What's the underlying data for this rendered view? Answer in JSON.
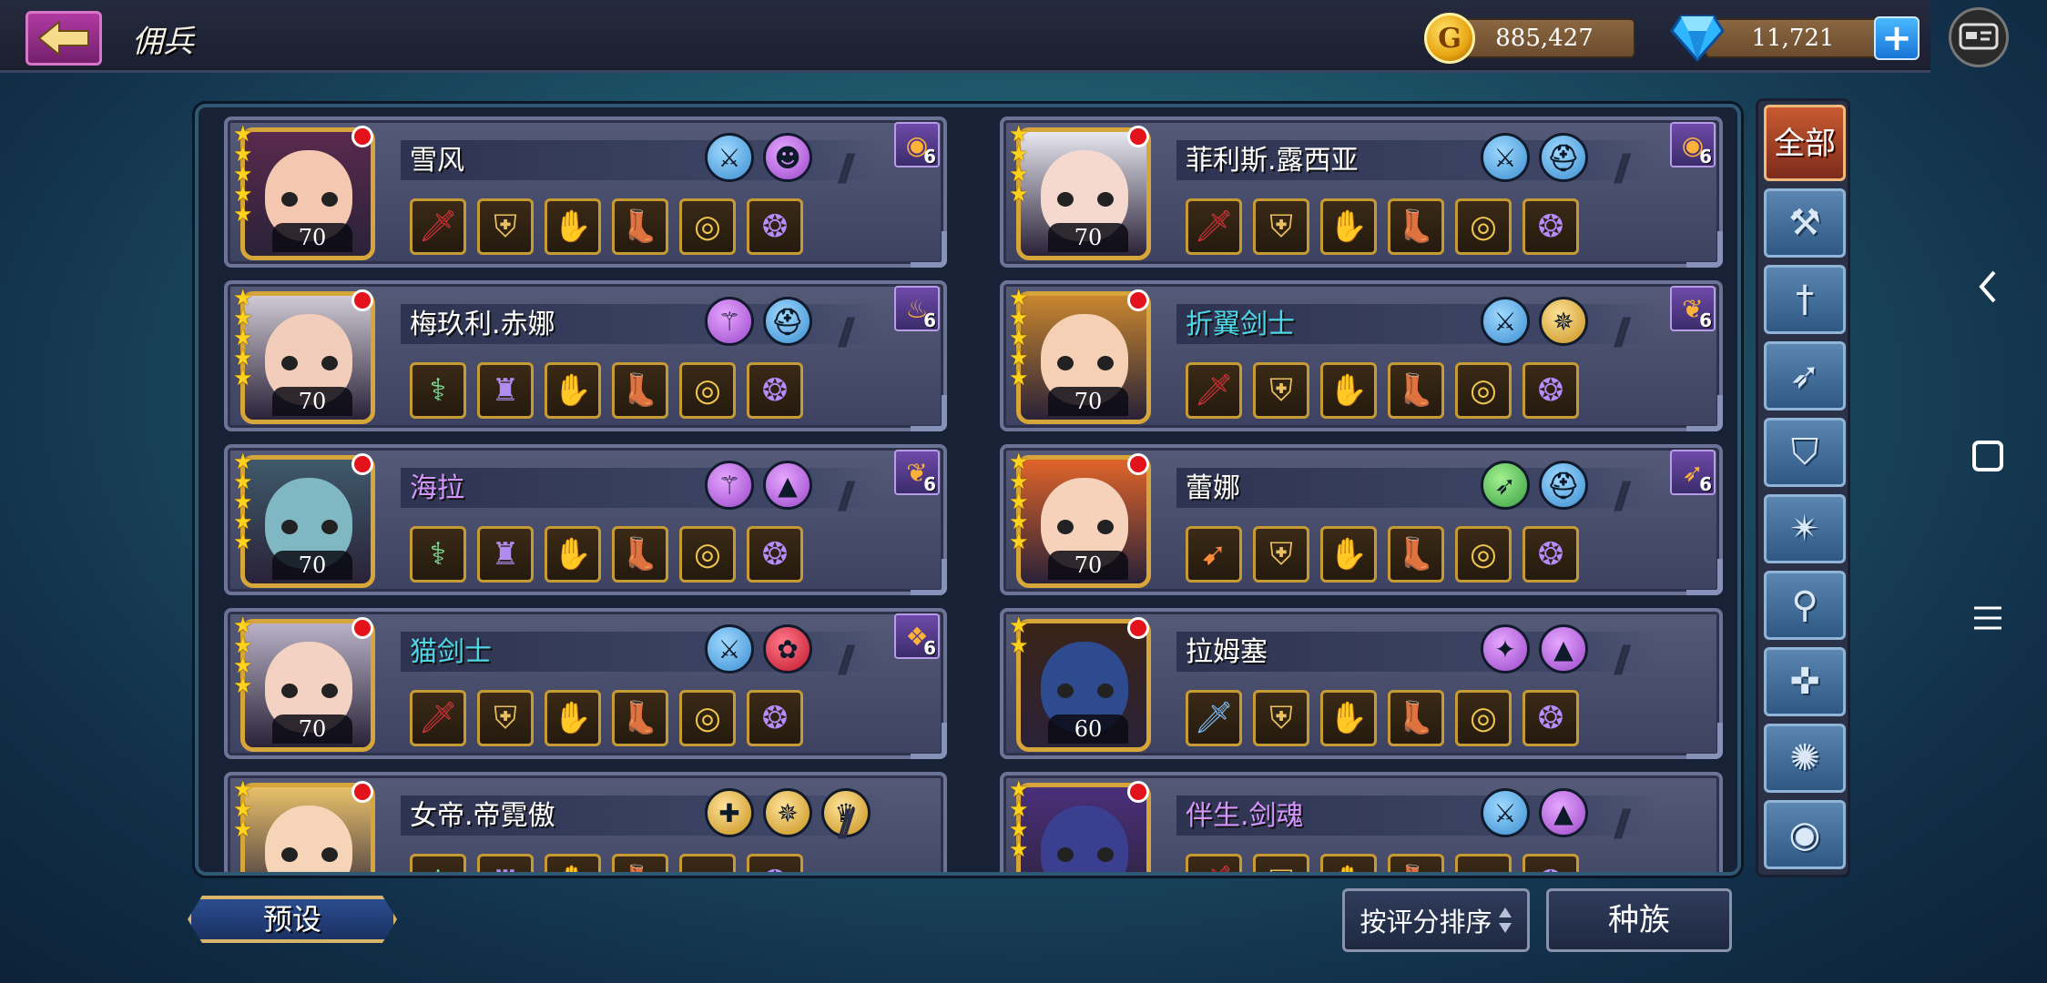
{
  "header": {
    "title": "佣兵",
    "gold": "885,427",
    "gems": "11,721",
    "coin_symbol": "G",
    "plus_label": "+"
  },
  "heroes": [
    {
      "name": "雪风",
      "level": "70",
      "stars": 5,
      "tier": "6",
      "name_color": "white",
      "portrait": {
        "skin": "#f4c7b0",
        "hair": "#5a2a4e"
      },
      "class_icons": [
        {
          "icon": "sword-class-icon",
          "style": "blue"
        },
        {
          "icon": "demon-race-icon",
          "style": "purple"
        }
      ],
      "tier_icon": "ring-emblem-icon",
      "equipment": [
        "red-dagger-icon",
        "gold-armor-icon",
        "red-gauntlet-icon",
        "red-boot-icon",
        "gold-ring-icon",
        "purple-amulet-icon"
      ]
    },
    {
      "name": "菲利斯.露西亚",
      "level": "70",
      "stars": 4,
      "tier": "6",
      "name_color": "white",
      "portrait": {
        "skin": "#f5d9cf",
        "hair": "#e7e7ef"
      },
      "class_icons": [
        {
          "icon": "sword-class-icon",
          "style": "blue"
        },
        {
          "icon": "helmet-race-icon",
          "style": "blue"
        }
      ],
      "tier_icon": "ring-emblem-icon",
      "equipment": [
        "red-dagger-icon",
        "gold-armor-icon",
        "red-gauntlet-icon",
        "red-boot-icon",
        "gold-ring-icon",
        "purple-amulet-icon"
      ]
    },
    {
      "name": "梅玖利.赤娜",
      "level": "70",
      "stars": 5,
      "tier": "6",
      "name_color": "white",
      "portrait": {
        "skin": "#f3cdbb",
        "hair": "#cfcad4"
      },
      "class_icons": [
        {
          "icon": "staff-class-icon",
          "style": "purple"
        },
        {
          "icon": "helmet-race-icon",
          "style": "blue"
        }
      ],
      "tier_icon": "flame-emblem-icon",
      "equipment": [
        "green-staff-icon",
        "purple-robe-icon",
        "red-gauntlet-icon",
        "red-boot-icon",
        "gold-ring-icon",
        "purple-amulet-icon"
      ]
    },
    {
      "name": "折翼剑士",
      "level": "70",
      "stars": 5,
      "tier": "6",
      "name_color": "teal",
      "portrait": {
        "skin": "#f6d0b4",
        "hair": "#c8862e"
      },
      "class_icons": [
        {
          "icon": "sword-class-icon",
          "style": "blue"
        },
        {
          "icon": "wings-race-icon",
          "style": "gold"
        }
      ],
      "tier_icon": "phoenix-emblem-icon",
      "equipment": [
        "red-dagger-icon",
        "gold-armor-icon",
        "red-gauntlet-icon",
        "red-boot-icon",
        "gold-ring-icon",
        "purple-amulet-icon"
      ]
    },
    {
      "name": "海拉",
      "level": "70",
      "stars": 5,
      "tier": "6",
      "name_color": "purple",
      "portrait": {
        "skin": "#7fb7c2",
        "hair": "#3f5a6b"
      },
      "class_icons": [
        {
          "icon": "staff-class-icon",
          "style": "purple"
        },
        {
          "icon": "hood-race-icon",
          "style": "purple"
        }
      ],
      "tier_icon": "phoenix-emblem-icon",
      "equipment": [
        "green-staff-icon",
        "purple-robe-icon",
        "red-gauntlet-icon",
        "red-boot-icon",
        "gold-ring-icon",
        "purple-amulet-icon"
      ]
    },
    {
      "name": "蕾娜",
      "level": "70",
      "stars": 5,
      "tier": "6",
      "name_color": "white",
      "portrait": {
        "skin": "#f7d2bb",
        "hair": "#e0642a"
      },
      "class_icons": [
        {
          "icon": "bow-class-icon",
          "style": "green"
        },
        {
          "icon": "helmet-race-icon",
          "style": "blue"
        }
      ],
      "tier_icon": "bow-emblem-icon",
      "equipment": [
        "fire-bow-icon",
        "gold-armor-icon",
        "red-gauntlet-icon",
        "red-boot-icon",
        "gold-ring-icon",
        "purple-amulet-icon"
      ]
    },
    {
      "name": "猫剑士",
      "level": "70",
      "stars": 4,
      "tier": "6",
      "name_color": "teal",
      "portrait": {
        "skin": "#f3d2c4",
        "hair": "#b9b2c6"
      },
      "class_icons": [
        {
          "icon": "sword-class-icon",
          "style": "blue"
        },
        {
          "icon": "paw-race-icon",
          "style": "red"
        }
      ],
      "tier_icon": "bat-emblem-icon",
      "equipment": [
        "red-dagger-icon",
        "gold-armor-icon",
        "red-gauntlet-icon",
        "red-boot-icon",
        "gold-ring-icon",
        "purple-amulet-icon"
      ]
    },
    {
      "name": "拉姆塞",
      "level": "60",
      "stars": 2,
      "tier": "",
      "name_color": "white",
      "portrait": {
        "skin": "#2e4b8f",
        "hair": "#3b2417"
      },
      "class_icons": [
        {
          "icon": "shuriken-class-icon",
          "style": "purple"
        },
        {
          "icon": "hood-race-icon",
          "style": "purple"
        }
      ],
      "tier_icon": "",
      "equipment": [
        "blue-sword-icon",
        "gold-armor-icon",
        "red-gauntlet-icon",
        "red-boot-icon",
        "gold-ring-icon",
        "purple-amulet-icon"
      ]
    },
    {
      "name": "女帝.帝霓傲",
      "level": "",
      "stars": 3,
      "tier": "",
      "name_color": "white",
      "portrait": {
        "skin": "#f6d4b8",
        "hair": "#e8c06a"
      },
      "class_icons": [
        {
          "icon": "cross-class-icon",
          "style": "gold"
        },
        {
          "icon": "wings-race-icon",
          "style": "gold"
        },
        {
          "icon": "crown-race-icon",
          "style": "gold"
        }
      ],
      "tier_icon": "",
      "equipment": [
        "green-staff-icon",
        "purple-robe-icon",
        "red-gauntlet-icon",
        "red-boot-icon",
        "gold-ring-icon",
        "purple-amulet-icon"
      ]
    },
    {
      "name": "伴生.剑魂",
      "level": "",
      "stars": 4,
      "tier": "",
      "name_color": "purple",
      "portrait": {
        "skin": "#3b3f8f",
        "hair": "#4a2f7a"
      },
      "class_icons": [
        {
          "icon": "sword-class-icon",
          "style": "blue"
        },
        {
          "icon": "hood-race-icon",
          "style": "purple"
        }
      ],
      "tier_icon": "",
      "equipment": [
        "red-dagger-icon",
        "gold-armor-icon",
        "red-gauntlet-icon",
        "red-boot-icon",
        "gold-ring-icon",
        "purple-amulet-icon"
      ]
    }
  ],
  "filters": {
    "all_label": "全部",
    "items": [
      "hammer-filter-icon",
      "sword-filter-icon",
      "bow-filter-icon",
      "shield-filter-icon",
      "shuriken-filter-icon",
      "staff-filter-icon",
      "cross-filter-icon",
      "spiral-filter-icon",
      "circle-filter-icon"
    ]
  },
  "footer": {
    "preset_label": "预设",
    "sort_label": "按评分排序",
    "race_label": "种族"
  },
  "colors": {
    "name_white": "#ffffff",
    "name_teal": "#4fd6e8",
    "name_purple": "#d595ff"
  }
}
